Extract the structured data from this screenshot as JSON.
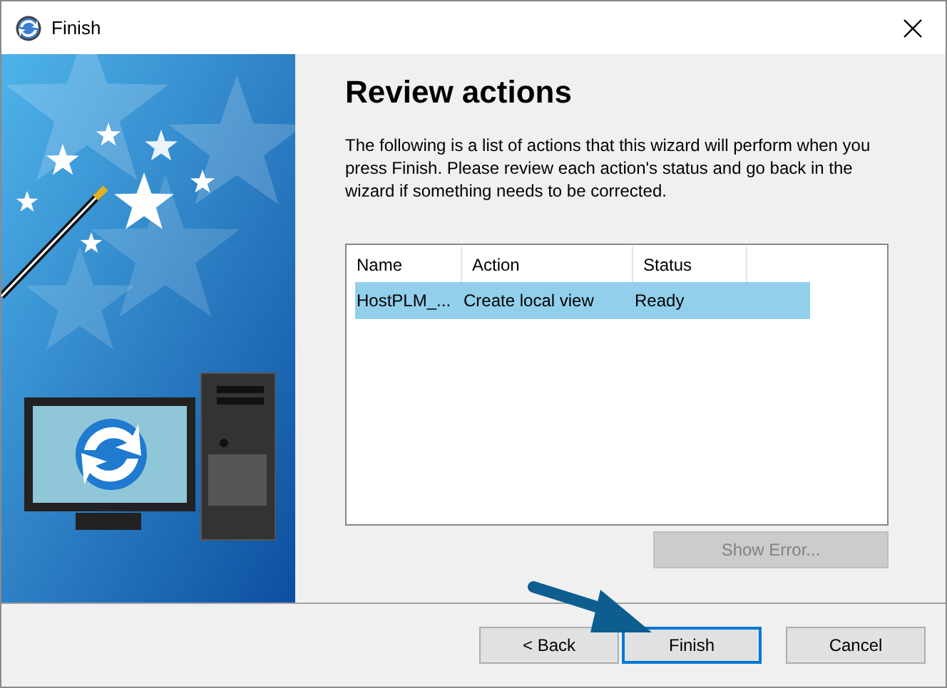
{
  "window": {
    "title": "Finish"
  },
  "heading": "Review actions",
  "description": "The following is a list of actions that this wizard will perform when you press Finish. Please review each action's status and go back in the wizard if something needs to be corrected.",
  "table": {
    "columns": [
      "Name",
      "Action",
      "Status"
    ],
    "rows": [
      {
        "cells": [
          "HostPLM_...",
          "Create local view",
          "Ready"
        ],
        "selected": true
      }
    ]
  },
  "show_error_button": {
    "label": "Show Error...",
    "disabled": true
  },
  "buttons": [
    {
      "label": "< Back",
      "focused": false
    },
    {
      "label": "Finish",
      "focused": true
    },
    {
      "label": "Cancel",
      "focused": false
    }
  ]
}
